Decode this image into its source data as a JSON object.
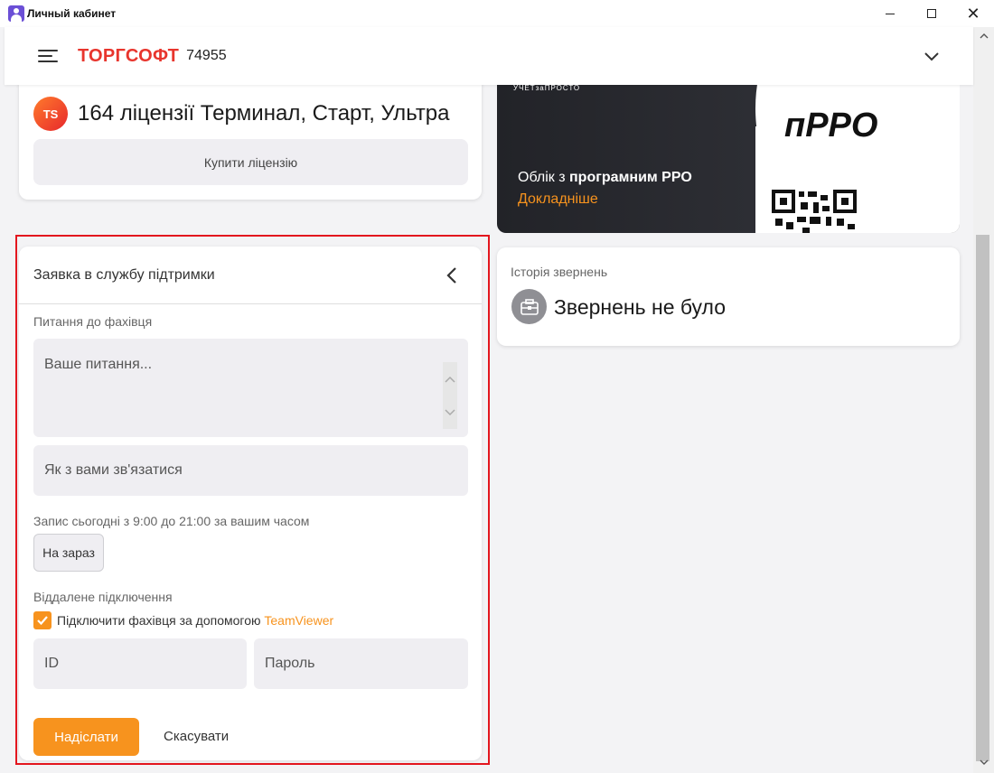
{
  "window": {
    "title": "Личный кабинет",
    "close_glyph": "✕"
  },
  "header": {
    "brand": "ТОРГСОФТ",
    "account_number": "74955"
  },
  "license": {
    "logo_text": "TS",
    "title": "164 ліцензії Терминал, Старт, Ультра",
    "buy_button": "Купити ліцензію"
  },
  "promo": {
    "barcode_text": "УЧЕТзаПРОСТО",
    "badge": "пРРО",
    "text_prefix": "Облік з ",
    "text_bold": "програмним РРО",
    "link": "Докладніше"
  },
  "support": {
    "title": "Заявка в службу підтримки",
    "question_label": "Питання до фахівця",
    "question_placeholder": "Ваше питання...",
    "contact_placeholder": "Як з вами зв'язатися",
    "schedule_label": "Запис сьогодні з 9:00 до 21:00 за вашим часом",
    "now_button": "На зараз",
    "remote_label": "Віддалене підключення",
    "teamviewer_checked": true,
    "teamviewer_text": "Підключити фахівця за допомогою ",
    "teamviewer_link": "TeamViewer",
    "id_placeholder": "ID",
    "password_placeholder": "Пароль",
    "submit_button": "Надіслати",
    "cancel_button": "Скасувати"
  },
  "history": {
    "label": "Історія звернень",
    "empty_text": "Звернень не було"
  },
  "colors": {
    "brand": "#e8352d",
    "accent": "#f7931e",
    "highlight": "#e3161e"
  }
}
